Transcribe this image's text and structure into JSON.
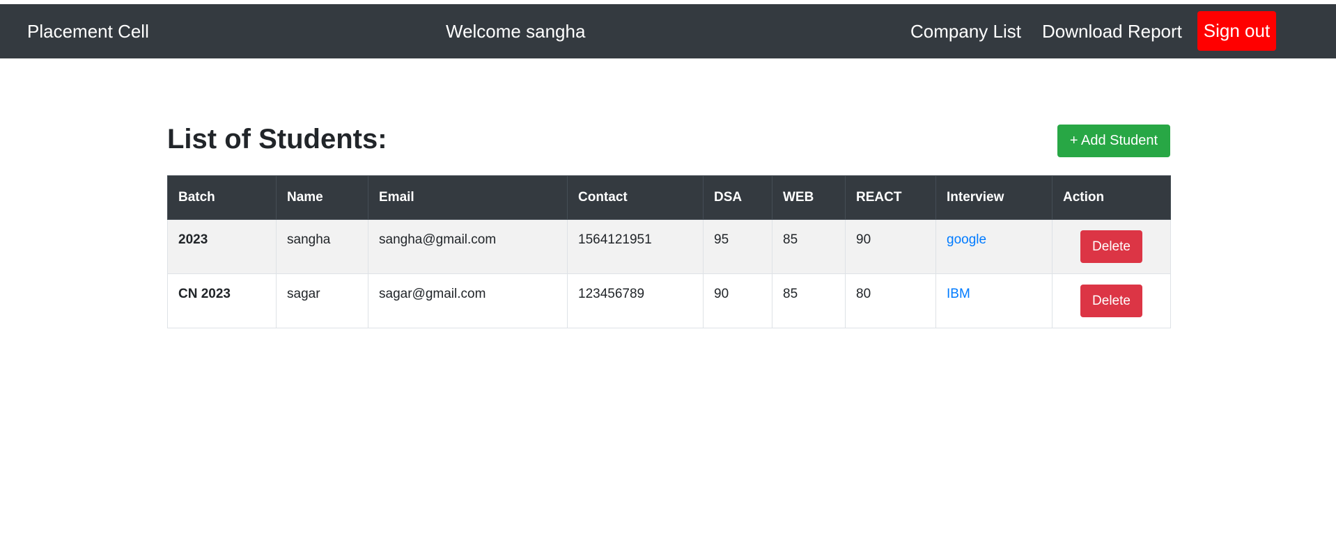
{
  "nav": {
    "brand": "Placement Cell",
    "welcome": "Welcome sangha",
    "company_list": "Company List",
    "download_report": "Download Report",
    "sign_out": "Sign out"
  },
  "main": {
    "title": "List of Students:",
    "add_button": "+ Add Student"
  },
  "table": {
    "headers": [
      "Batch",
      "Name",
      "Email",
      "Contact",
      "DSA",
      "WEB",
      "REACT",
      "Interview",
      "Action"
    ],
    "rows": [
      {
        "batch": "2023",
        "name": "sangha",
        "email": "sangha@gmail.com",
        "contact": "1564121951",
        "dsa": "95",
        "web": "85",
        "react": "90",
        "interview": "google",
        "action": "Delete"
      },
      {
        "batch": "CN 2023",
        "name": "sagar",
        "email": "sagar@gmail.com",
        "contact": "123456789",
        "dsa": "90",
        "web": "85",
        "react": "80",
        "interview": "IBM",
        "action": "Delete"
      }
    ]
  },
  "colors": {
    "navbar": "#343a40",
    "sign_out": "#ff0000",
    "add_button": "#28a745",
    "delete_button": "#dc3545",
    "link": "#007bff"
  }
}
